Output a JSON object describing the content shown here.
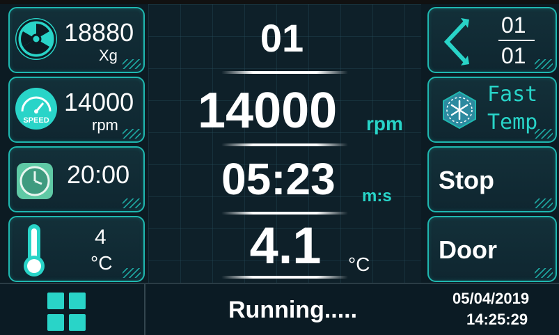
{
  "left_panel": {
    "rcf": {
      "icon": "radiation-icon",
      "value": "18880",
      "unit": "Xg"
    },
    "speed": {
      "icon": "speed-gauge-icon",
      "icon_label": "SPEED",
      "value": "14000",
      "unit": "rpm"
    },
    "time": {
      "icon": "clock-icon",
      "value": "20:00"
    },
    "temperature": {
      "icon": "thermometer-icon",
      "value": "4",
      "unit": "°C"
    }
  },
  "center": {
    "program_number": "01",
    "speed_value": "14000",
    "speed_unit": "rpm",
    "time_value": "05:23",
    "time_unit": "m:s",
    "temp_value": "4.1",
    "temp_unit": "°C"
  },
  "right_panel": {
    "program": {
      "icon": "program-switch-icon",
      "current": "01",
      "total": "01"
    },
    "fast_temp": {
      "icon": "snowflake-icon",
      "line1": "Fast",
      "line2": "Temp"
    },
    "stop_label": "Stop",
    "door_label": "Door"
  },
  "status_bar": {
    "menu_icon": "menu-grid-icon",
    "status_text": "Running.....",
    "date": "05/04/2019",
    "time": "14:25:29"
  },
  "colors": {
    "accent": "#28d4c8",
    "border": "#1fb8b0",
    "background": "#0c1b23"
  }
}
